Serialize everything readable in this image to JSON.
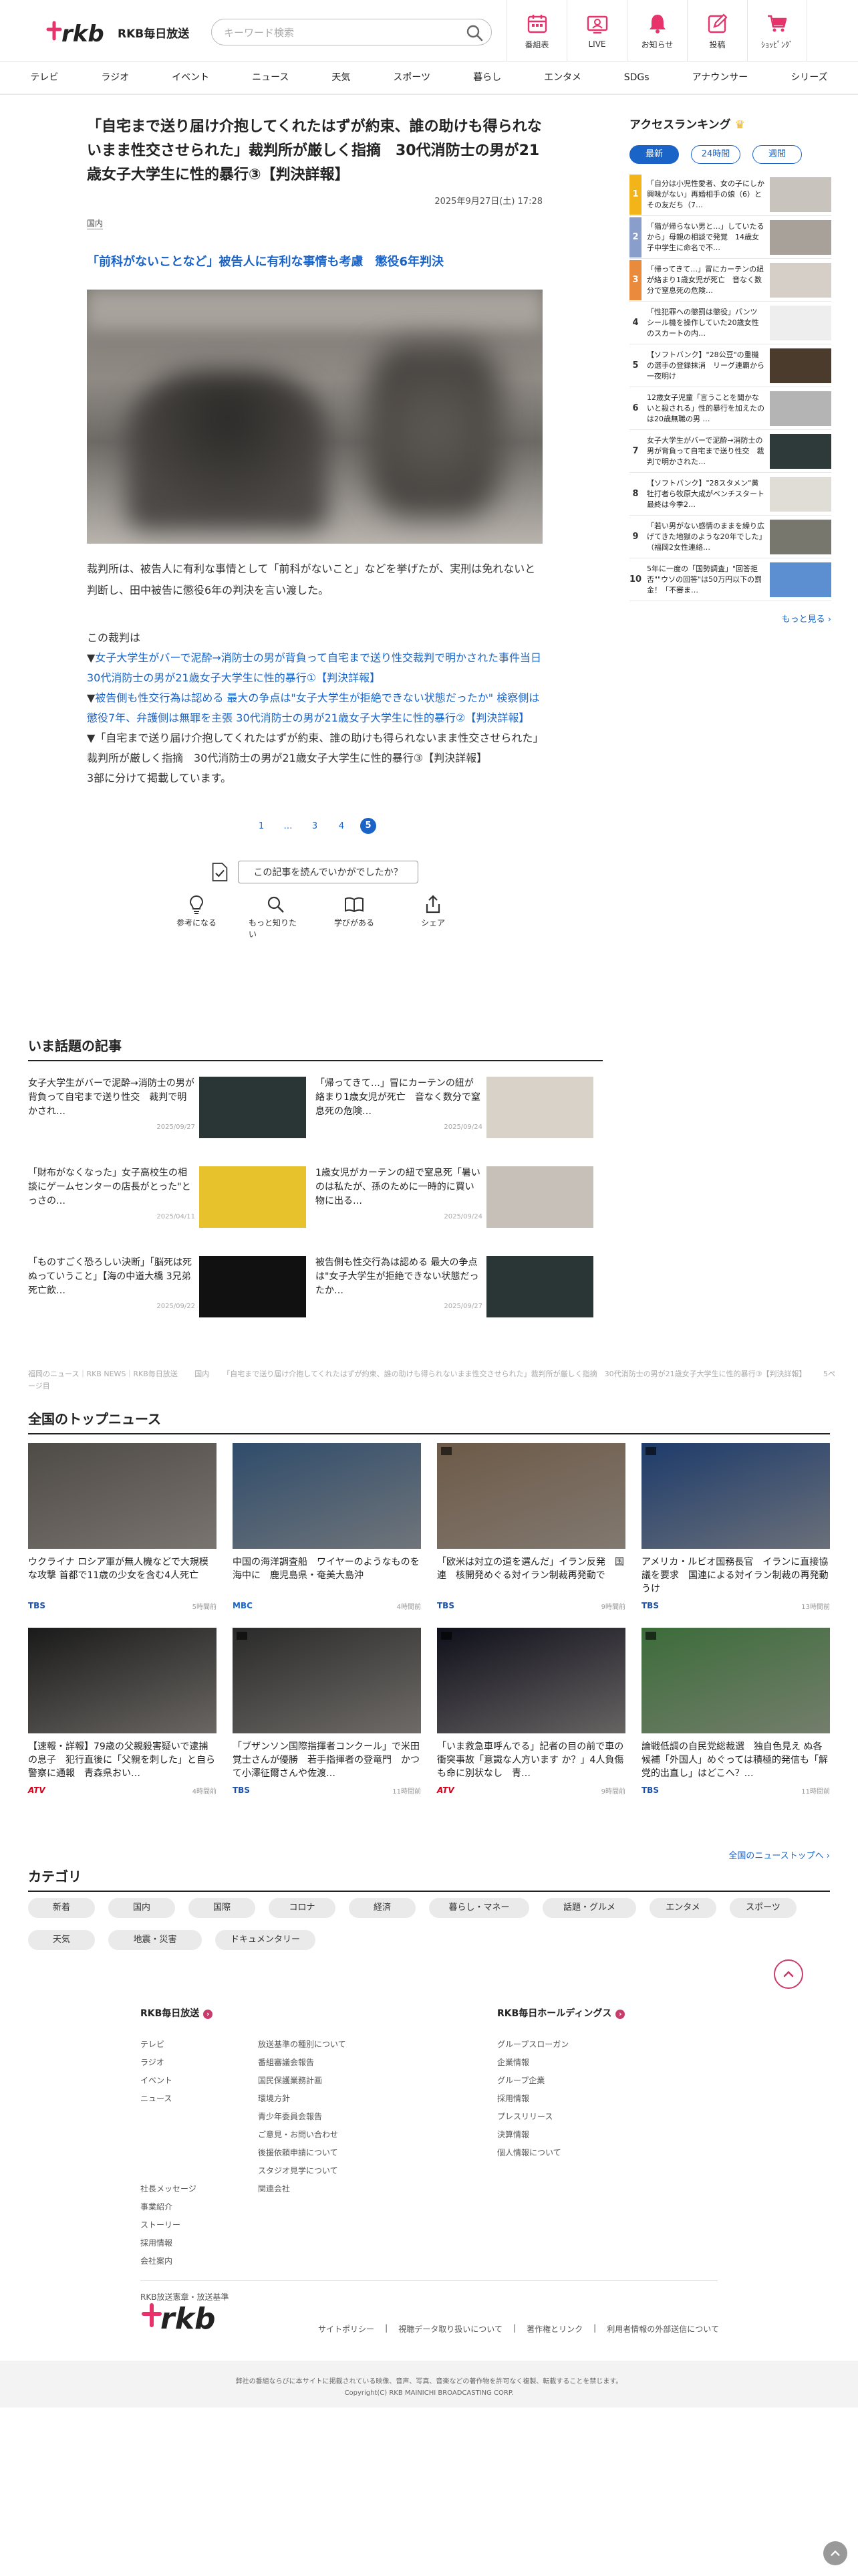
{
  "header": {
    "logo": "rkb",
    "station": "RKB毎日放送",
    "search_placeholder": "キーワード検索",
    "nav": [
      {
        "label": "番組表",
        "icon": "calendar-icon"
      },
      {
        "label": "LIVE",
        "icon": "live-icon"
      },
      {
        "label": "お知らせ",
        "icon": "bell-icon"
      },
      {
        "label": "投稿",
        "icon": "post-icon"
      },
      {
        "label": "ｼｮｯﾋﾟﾝｸﾞ",
        "icon": "cart-icon"
      }
    ]
  },
  "categories_nav": [
    "テレビ",
    "ラジオ",
    "イベント",
    "ニュース",
    "天気",
    "スポーツ",
    "暮らし",
    "エンタメ",
    "SDGs",
    "アナウンサー",
    "シリーズ"
  ],
  "article": {
    "title": "「自宅まで送り届け介抱してくれたはずが約束、誰の助けも得られないまま性交させられた」裁判所が厳しく指摘　30代消防士の男が21歳女子大学生に性的暴行③【判決詳報】",
    "date": "2025年9月27日(土) 17:28",
    "genre": "国内",
    "subhead": "「前科がないことなど」被告人に有利な事情も考慮　懲役6年判決",
    "body": "裁判所は、被告人に有利な事情として「前科がないこと」などを挙げたが、実刑は免れないと判断し、田中被告に懲役6年の判決を言い渡した。",
    "links_intro": "この裁判は",
    "links": [
      {
        "prefix": "▼",
        "text": "女子大学生がバーで泥酔→消防士の男が背負って自宅まで送り性交裁判で明かされた事件当日　30代消防士の男が21歳女子大学生に性的暴行①【判決詳報】",
        "link": true
      },
      {
        "prefix": "▼",
        "text": "被告側も性交行為は認める 最大の争点は\"女子大学生が拒絶できない状態だったか\" 検察側は懲役7年、弁護側は無罪を主張 30代消防士の男が21歳女子大学生に性的暴行②【判決詳報】",
        "link": true
      },
      {
        "prefix": "▼",
        "text": "「自宅まで送り届け介抱してくれたはずが約束、誰の助けも得られないまま性交させられた」裁判所が厳しく指摘　30代消防士の男が21歳女子大学生に性的暴行③【判決詳報】",
        "link": false
      }
    ],
    "links_outro": "3部に分けて掲載しています。",
    "pager": [
      "1",
      "…",
      "3",
      "4",
      "5"
    ],
    "pager_current": "5",
    "feedback_q": "この記事を読んでいかがでしたか？",
    "reactions": [
      {
        "label": "参考になる",
        "icon": "bulb-icon"
      },
      {
        "label": "もっと知りたい",
        "icon": "magnifier-icon"
      },
      {
        "label": "学びがある",
        "icon": "book-icon"
      },
      {
        "label": "シェア",
        "icon": "share-icon"
      }
    ]
  },
  "ranking": {
    "title": "アクセスランキング",
    "tabs": [
      "最新",
      "24時間",
      "週間"
    ],
    "active_tab": "最新",
    "items": [
      {
        "num": "1",
        "text": "「自分は小児性愛者、女の子にしか興味がない」再婚相手の娘（6）とその友だち（7…",
        "thumb": "#c9c3bd"
      },
      {
        "num": "2",
        "text": "「猫が帰らない男と…」していたるから」母親の相談で発覚　14歳女子中学生に命名で不…",
        "thumb": "#a7a19a"
      },
      {
        "num": "3",
        "text": "「帰ってきて…」冒にカーテンの紐が絡まり1歳女児が死亡　音なく数分で窒息死の危険…",
        "thumb": "#d6cfc8"
      },
      {
        "num": "4",
        "text": "「性犯罪への懲罰は懲役」パンツシール機を操作していた20歳女性のスカートの内…",
        "thumb": "#eeeeee"
      },
      {
        "num": "5",
        "text": "【ソフトバンク】\"28公豆\"の重機の選手の登録抹消　リーグ連覇から一夜明け",
        "thumb": "#4b3b2c"
      },
      {
        "num": "6",
        "text": "12歳女子児童「言うことを聞かないと殺される」性的暴行を加えたのは20歳無職の男 …",
        "thumb": "#b4b4b4"
      },
      {
        "num": "7",
        "text": "女子大学生がバーで泥酔→消防士の男が背負って自宅まで送り性交　裁判で明かされた…",
        "thumb": "#2e3a3a"
      },
      {
        "num": "8",
        "text": "【ソフトバンク】\"28スタメン\"黄牡打者ら牧原大成がベンチスタート　最終は今季2…",
        "thumb": "#e0ddd7"
      },
      {
        "num": "9",
        "text": "「若い男がない感情のままを繰り広げてきた地獄のような20年でした」（福岡2女性連絡…",
        "thumb": "#78776e"
      },
      {
        "num": "10",
        "text": "5年に一度の「国勢調査」\"回答拒否\"\"ウソの回答\"は50万円以下の罰金！「不審ま…",
        "thumb": "#5b8fd1"
      }
    ],
    "more": "もっと見る ›"
  },
  "topical": {
    "title": "いま話題の記事",
    "items": [
      {
        "text": "女子大学生がバーで泥酔→消防士の男が背負って自宅まで送り性交　裁判で明かされ…",
        "date": "2025/09/27",
        "thumb": "#2a3535"
      },
      {
        "text": "「帰ってきて…」冒にカーテンの紐が絡まり1歳女児が死亡　音なく数分で窒息死の危険…",
        "date": "2025/09/24",
        "thumb": "#d9d2c9"
      },
      {
        "text": "「財布がなくなった」女子高校生の相談にゲームセンターの店長がとった\"とっさの…",
        "date": "2025/04/11",
        "thumb": "#e8c22d"
      },
      {
        "text": "1歳女児がカーテンの紐で窒息死「暑いのは私たが、孫のために一時的に買い物に出る…",
        "date": "2025/09/24",
        "thumb": "#c7c0b8"
      },
      {
        "text": "「ものすごく恐ろしい決断」「脳死は死ぬっていうこと」【海の中道大橋 3兄弟死亡飲…",
        "date": "2025/09/22",
        "thumb": "#111111"
      },
      {
        "text": "被告側も性交行為は認める 最大の争点は\"女子大学生が拒絶できない状態だったか…",
        "date": "2025/09/27",
        "thumb": "#2a3535"
      }
    ]
  },
  "breadcrumb": "福岡のニュース｜RKB NEWS｜RKB毎日放送 　　国内 　　「自宅まで送り届け介抱してくれたはずが約束、誰の助けも得られないまま性交させられた」裁判所が厳しく指摘　30代消防士の男が21歳女子大学生に性的暴行③【判決詳報】 　　5ページ目",
  "national": {
    "title": "全国のトップニュース",
    "items": [
      {
        "text": "ウクライナ ロシア軍が無人機などで大規模な攻撃 首都で11歳の少女を含む4人死亡",
        "source": "TBS",
        "src_class": "tbs",
        "date": "5時間前",
        "thumb": "#4e4a45",
        "play": false
      },
      {
        "text": "中国の海洋調査船　ワイヤーのようなものを海中に　鹿児島県・奄美大島沖",
        "source": "MBC",
        "src_class": "mbc",
        "date": "4時間前",
        "thumb": "#2f4c6b",
        "play": false
      },
      {
        "text": "「欧米は対立の道を選んだ」イラン反発　国連　核開発めぐる対イラン制裁再発動で",
        "source": "TBS",
        "src_class": "tbs",
        "date": "9時間前",
        "thumb": "#6d5a48",
        "play": true
      },
      {
        "text": "アメリカ・ルビオ国務長官　イランに直接協議を要求　国連による対イラン制裁の再発動うけ",
        "source": "TBS",
        "src_class": "tbs",
        "date": "13時間前",
        "thumb": "#1d3b6a",
        "play": true
      },
      {
        "text": "【速報・詳報】79歳の父親殺害疑いで逮捕の息子　犯行直後に「父親を刺した」と自ら警察に通報　青森県おい…",
        "source": "ATV",
        "src_class": "atv",
        "date": "4時間前",
        "thumb": "#1a1a1a",
        "play": false
      },
      {
        "text": "「ブザンソン国際指揮者コンクール」で米田覚士さんが優勝　若手指揮者の登竜門　かつて小澤征爾さんや佐渡…",
        "source": "TBS",
        "src_class": "tbs",
        "date": "11時間前",
        "thumb": "#2a2a2a",
        "play": true
      },
      {
        "text": "「いま救急車呼んでる」記者の目の前で車の衝突事故「意識な人方います か？」4人負傷も命に別状なし　青…",
        "source": "ATV",
        "src_class": "atv",
        "date": "9時間前",
        "thumb": "#0f0f1a",
        "play": true
      },
      {
        "text": "論戦低調の自民党総裁選　独自色見え ぬ各候補「外国人」めぐっては積極的発信も「解党的出直し」はどこへ？…",
        "source": "TBS",
        "src_class": "tbs",
        "date": "11時間前",
        "thumb": "#3c6c3a",
        "play": true
      }
    ],
    "more": "全国のニューストップへ ›"
  },
  "category": {
    "title": "カテゴリ",
    "items": [
      "新着",
      "国内",
      "国際",
      "コロナ",
      "経済",
      "暮らし・マネー",
      "話題・グルメ",
      "エンタメ",
      "スポーツ",
      "天気",
      "地震・災害",
      "ドキュメンタリー"
    ]
  },
  "footer": {
    "col1_title": "RKB毎日放送",
    "col1a": [
      "テレビ",
      "ラジオ",
      "イベント",
      "ニュース",
      "",
      "",
      "",
      "",
      "社長メッセージ",
      "事業紹介",
      "ストーリー",
      "採用情報",
      "会社案内",
      "",
      "RKB放送憲章・放送基準"
    ],
    "col1b": [
      "放送基準の種別について",
      "番組審議会報告",
      "国民保護業務計画",
      "環境方針",
      "青少年委員会報告",
      "ご意見・お問い合わせ",
      "後援依頼申請について",
      "スタジオ見学について",
      "関連会社"
    ],
    "col2_title": "RKB毎日ホールディングス",
    "col2": [
      "グループスローガン",
      "企業情報",
      "グループ企業",
      "採用情報",
      "プレスリリース",
      "決算情報",
      "個人情報について"
    ],
    "logo": "rkb",
    "links": [
      "サイトポリシー",
      "|",
      "視聴データ取り扱いについて",
      "|",
      "著作権とリンク",
      "|",
      "利用者情報の外部送信について"
    ],
    "copy1": "弊社の番組ならびに本サイトに掲載されている映像、音声、写真、音楽などの著作物を許可なく複製、転載することを禁じます。",
    "copy2": "Copyright(C) RKB MAINICHI BROADCASTING CORP."
  },
  "colors": {
    "accent": "#1a64c8",
    "brand": "#e8326b",
    "rank_gold": "#f2b418"
  }
}
